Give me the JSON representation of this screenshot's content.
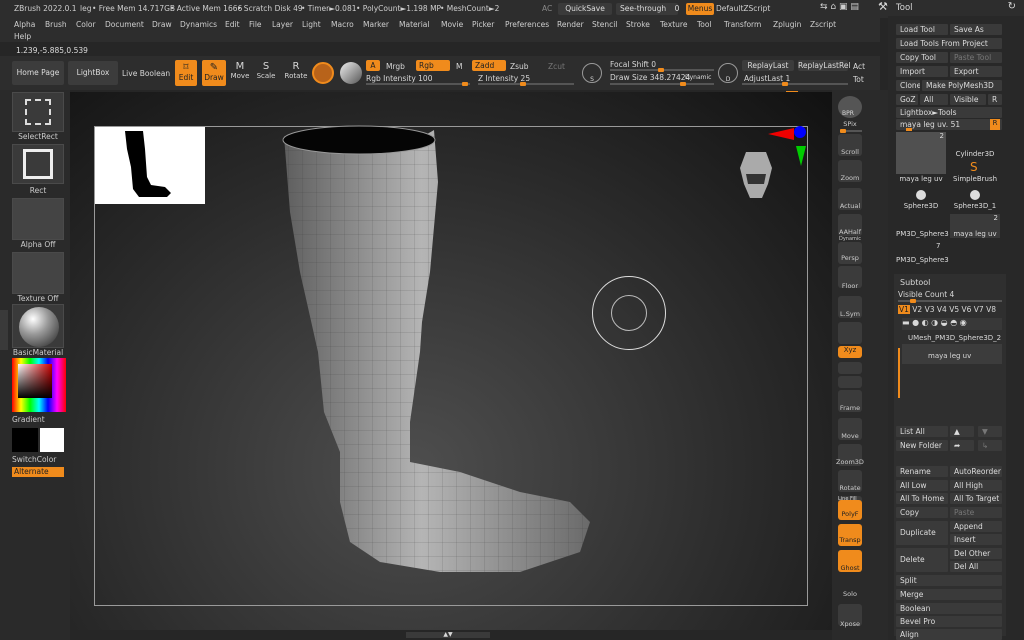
{
  "titlebar": {
    "app": "ZBrush 2022.0.1",
    "doc": "leg",
    "free_mem": "• Free Mem 14.717GB",
    "active_mem": "• Active Mem 1666",
    "scratch": "• Scratch Disk 49",
    "timer": "• Timer►0.081",
    "polycount": "• PolyCount►1.198 MP",
    "meshcount": "• MeshCount►2",
    "ac": "AC",
    "quicksave": "QuickSave",
    "see_through": "See-through",
    "see_through_val": "0",
    "menus": "Menus",
    "script": "DefaultZScript"
  },
  "menus": [
    "Alpha",
    "Brush",
    "Color",
    "Document",
    "Draw",
    "Dynamics",
    "Edit",
    "File",
    "Layer",
    "Light",
    "Macro",
    "Marker",
    "Material",
    "Movie",
    "Picker",
    "Preferences",
    "Render",
    "Stencil",
    "Stroke",
    "Texture",
    "Tool",
    "Transform",
    "Zplugin",
    "Zscript"
  ],
  "help": "Help",
  "coords": "1.239,-5.885,0.539",
  "toolbar": {
    "home": "Home Page",
    "lightbox": "LightBox",
    "live_boolean": "Live Boolean",
    "edit": "Edit",
    "draw": "Draw",
    "move": "Move",
    "scale": "Scale",
    "rotate": "Rotate",
    "a": "A",
    "mrgb": "Mrgb",
    "rgb": "Rgb",
    "m": "M",
    "zadd": "Zadd",
    "zsub": "Zsub",
    "zcut": "Zcut",
    "rgb_intensity": "Rgb Intensity 100",
    "z_intensity": "Z Intensity 25",
    "focal_shift": "Focal Shift 0",
    "draw_size": "Draw Size 348.27424",
    "dynamic": "Dynamic",
    "replay_last": "ReplayLast",
    "replay_last_rel": "ReplayLastRel",
    "adjust_last": "AdjustLast 1",
    "act": "Act",
    "tot": "Tot",
    "s": "S",
    "d": "D"
  },
  "left": {
    "select_rect": "SelectRect",
    "rect": "Rect",
    "alpha_off": "Alpha Off",
    "texture_off": "Texture Off",
    "material": "BasicMaterial",
    "gradient": "Gradient",
    "switch_color": "SwitchColor",
    "alternate": "Alternate"
  },
  "right": [
    "BPR",
    "SPix",
    "Scroll",
    "Zoom",
    "Actual",
    "AAHalf",
    "Persp",
    "Floor",
    "L.Sym",
    "Xyz",
    "Frame",
    "Move",
    "Zoom3D",
    "Rotate",
    "PolyF",
    "Transp",
    "Ghost",
    "Solo",
    "Xpose"
  ],
  "right_extra": {
    "dynamic": "Dynamic",
    "line_fill": "Line Fill"
  },
  "panel": {
    "title": "Tool",
    "load_tool": "Load Tool",
    "save_as": "Save As",
    "load_from_project": "Load Tools From Project",
    "copy_tool": "Copy Tool",
    "paste_tool": "Paste Tool",
    "import": "Import",
    "export": "Export",
    "clone": "Clone",
    "make_polymesh": "Make PolyMesh3D",
    "goz": "GoZ",
    "all": "All",
    "visible": "Visible",
    "r": "R",
    "lightbox_tools": "Lightbox►Tools",
    "current_tool": "maya leg uv.",
    "current_tool_count": "51",
    "tools": [
      {
        "name": "maya leg uv",
        "count": "2"
      },
      {
        "name": "Cylinder3D",
        "count": ""
      },
      {
        "name": "SimpleBrush",
        "count": ""
      },
      {
        "name": "Sphere3D",
        "count": ""
      },
      {
        "name": "Sphere3D_1",
        "count": ""
      },
      {
        "name": "PM3D_Sphere3",
        "count": ""
      },
      {
        "name": "maya leg uv",
        "count": "2"
      },
      {
        "name": "PM3D_Sphere3",
        "count": "7"
      }
    ],
    "subtool": "Subtool",
    "visible_count": "Visible Count 4",
    "versions": [
      "V1",
      "V2",
      "V3",
      "V4",
      "V5",
      "V6",
      "V7",
      "V8"
    ],
    "subtool_items": [
      "UMesh_PM3D_Sphere3D_2",
      "maya leg uv"
    ],
    "list_all": "List All",
    "new_folder": "New Folder",
    "rename": "Rename",
    "auto_reorder": "AutoReorder",
    "all_low": "All Low",
    "all_high": "All High",
    "all_to_home": "All To Home",
    "all_to_target": "All To Target",
    "copy": "Copy",
    "paste": "Paste",
    "duplicate": "Duplicate",
    "append": "Append",
    "insert": "Insert",
    "delete": "Delete",
    "del_other": "Del Other",
    "del_all": "Del All",
    "split": "Split",
    "merge": "Merge",
    "boolean": "Boolean",
    "bevel_pro": "Bevel Pro",
    "align": "Align"
  }
}
